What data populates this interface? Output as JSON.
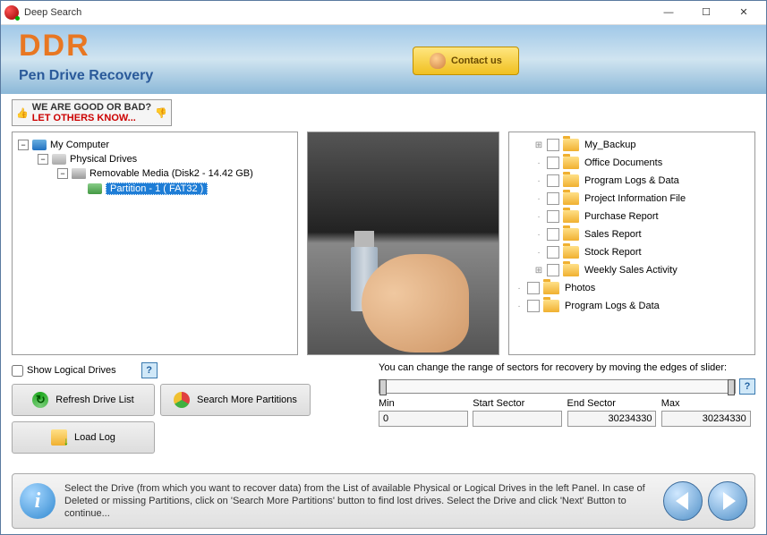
{
  "window": {
    "title": "Deep Search"
  },
  "banner": {
    "logo": "DDR",
    "product": "Pen Drive Recovery",
    "contact": "Contact us"
  },
  "feedback": {
    "line1": "WE ARE GOOD OR BAD?",
    "line2": "LET OTHERS KNOW..."
  },
  "tree": {
    "root": "My Computer",
    "physical": "Physical Drives",
    "removable": "Removable Media (Disk2 - 14.42 GB)",
    "partition": "Partition - 1 ( FAT32 )"
  },
  "folders": [
    {
      "name": "My_Backup",
      "expandable": true,
      "indent": 1
    },
    {
      "name": "Office Documents",
      "expandable": false,
      "indent": 1
    },
    {
      "name": "Program Logs & Data",
      "expandable": false,
      "indent": 1
    },
    {
      "name": "Project Information File",
      "expandable": false,
      "indent": 1
    },
    {
      "name": "Purchase Report",
      "expandable": false,
      "indent": 1
    },
    {
      "name": "Sales Report",
      "expandable": false,
      "indent": 1
    },
    {
      "name": "Stock Report",
      "expandable": false,
      "indent": 1
    },
    {
      "name": "Weekly Sales Activity",
      "expandable": true,
      "indent": 1
    },
    {
      "name": "Photos",
      "expandable": false,
      "indent": 0
    },
    {
      "name": "Program Logs & Data",
      "expandable": false,
      "indent": 0
    }
  ],
  "controls": {
    "show_logical": "Show Logical Drives",
    "refresh": "Refresh Drive List",
    "search_more": "Search More Partitions",
    "load_log": "Load Log"
  },
  "sectors": {
    "hint": "You can change the range of sectors for recovery by moving the edges of slider:",
    "min_label": "Min",
    "start_label": "Start Sector",
    "end_label": "End Sector",
    "max_label": "Max",
    "min": "0",
    "start": "",
    "end": "30234330",
    "max": "30234330"
  },
  "footer": {
    "text": "Select the Drive (from which you want to recover data) from the List of available Physical or Logical Drives in the left Panel. In case of Deleted or missing Partitions, click on 'Search More Partitions' button to find lost drives. Select the Drive and click 'Next' Button to continue..."
  }
}
